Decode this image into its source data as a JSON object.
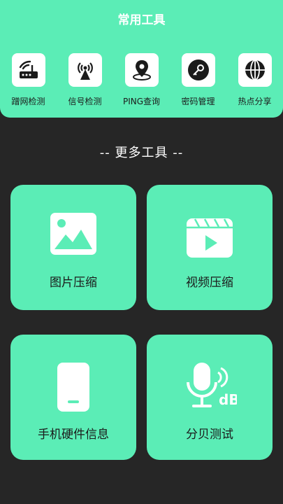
{
  "top_panel": {
    "title": "常用工具",
    "tools": [
      {
        "label": "蹭网检测",
        "icon": "router-icon"
      },
      {
        "label": "信号检测",
        "icon": "signal-tower-icon"
      },
      {
        "label": "PING查询",
        "icon": "location-pin-icon"
      },
      {
        "label": "密码管理",
        "icon": "key-icon"
      },
      {
        "label": "热点分享",
        "icon": "globe-icon"
      }
    ]
  },
  "more_tools": {
    "title": "--  更多工具  --",
    "cards": [
      {
        "label": "图片压缩",
        "icon": "image-icon"
      },
      {
        "label": "视频压缩",
        "icon": "video-clapper-icon"
      },
      {
        "label": "手机硬件信息",
        "icon": "phone-icon"
      },
      {
        "label": "分贝测试",
        "icon": "microphone-db-icon"
      }
    ]
  },
  "colors": {
    "accent": "#5bedb6",
    "background": "#262626",
    "text_dark": "#1b1b1b"
  }
}
